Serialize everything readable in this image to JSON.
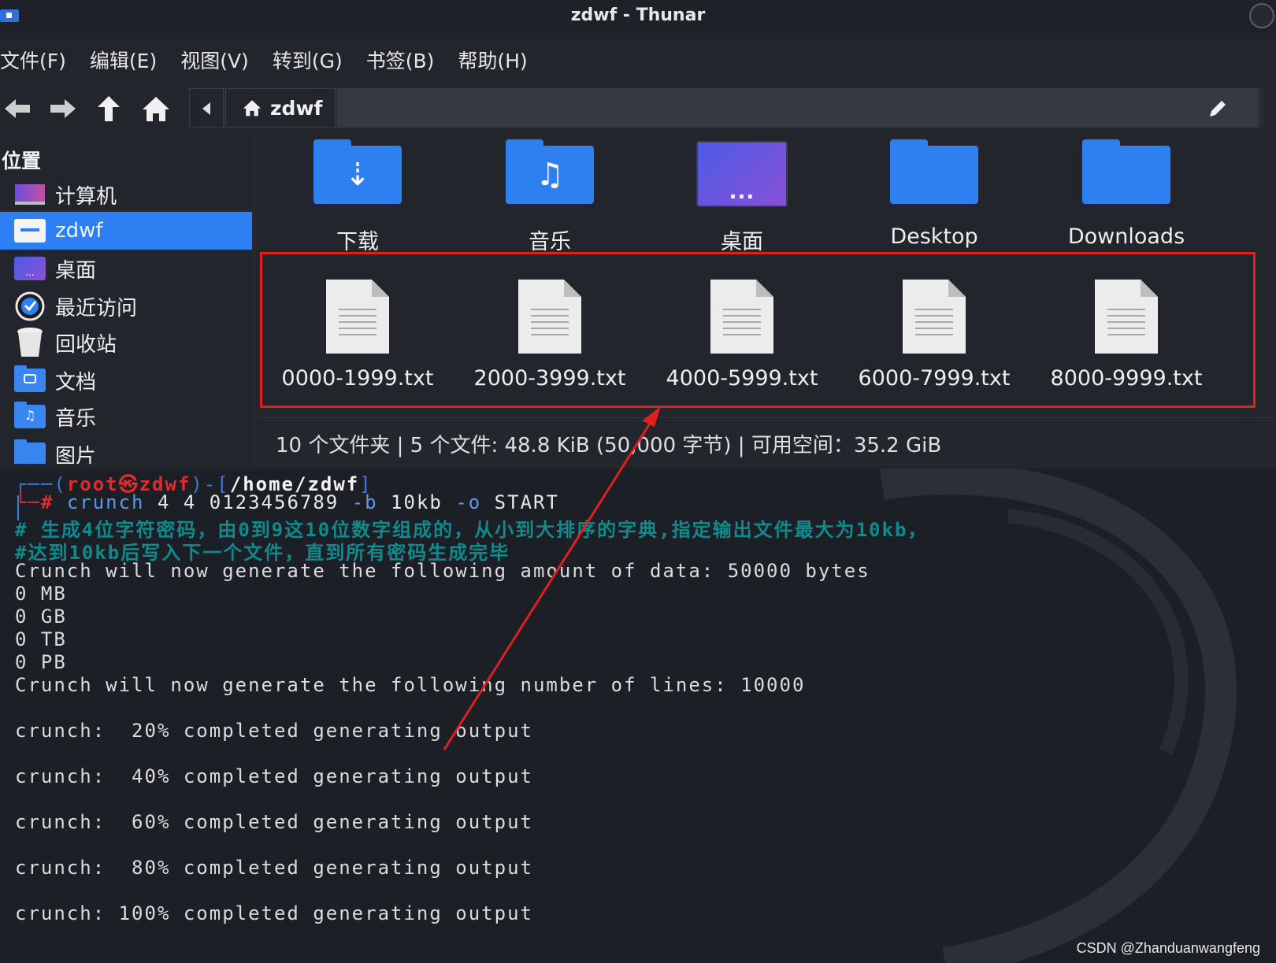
{
  "window": {
    "title": "zdwf - Thunar"
  },
  "menubar": [
    "文件(F)",
    "编辑(E)",
    "视图(V)",
    "转到(G)",
    "书签(B)",
    "帮助(H)"
  ],
  "pathbar": {
    "crumb": "zdwf"
  },
  "sidebar": {
    "heading": "位置",
    "items": [
      {
        "label": "计算机",
        "icon": "computer-icon"
      },
      {
        "label": "zdwf",
        "icon": "home-folder-icon",
        "active": true
      },
      {
        "label": "桌面",
        "icon": "desktop-folder-icon"
      },
      {
        "label": "最近访问",
        "icon": "recent-clock-icon"
      },
      {
        "label": "回收站",
        "icon": "trash-icon"
      },
      {
        "label": "文档",
        "icon": "documents-folder-icon"
      },
      {
        "label": "音乐",
        "icon": "music-folder-icon"
      },
      {
        "label": "图片",
        "icon": "pictures-folder-icon"
      }
    ]
  },
  "folders": [
    {
      "label": "下载",
      "icon": "download-folder-icon"
    },
    {
      "label": "音乐",
      "icon": "music-folder-icon"
    },
    {
      "label": "桌面",
      "icon": "desktop-folder-icon"
    },
    {
      "label": "Desktop",
      "icon": "folder-icon"
    },
    {
      "label": "Downloads",
      "icon": "folder-icon"
    }
  ],
  "files": [
    {
      "label": "0000-1999.txt"
    },
    {
      "label": "2000-3999.txt"
    },
    {
      "label": "4000-5999.txt"
    },
    {
      "label": "6000-7999.txt"
    },
    {
      "label": "8000-9999.txt"
    }
  ],
  "status": "10 个文件夹 | 5 个文件: 48.8 KiB (50,000 字节) | 可用空间：35.2 GiB",
  "terminal": {
    "prompt_open": "┌──(",
    "prompt_user": "root㉿zdwf",
    "prompt_mid": ")-[",
    "prompt_path": "/home/zdwf",
    "prompt_close": "]",
    "prompt_hash": "└─#",
    "cmd_name": "crunch",
    "cmd_args1": " 4 4 0123456789 ",
    "cmd_flag_b": "-b",
    "cmd_args2": " 10kb ",
    "cmd_flag_o": "-o",
    "cmd_args3": " START",
    "comment1": "# 生成4位字符密码，由0到9这10位数字组成的，从小到大排序的字典,指定输出文件最大为10kb，",
    "comment2": "#达到10kb后写入下一个文件，直到所有密码生成完毕",
    "output": [
      "Crunch will now generate the following amount of data: 50000 bytes",
      "0 MB",
      "0 GB",
      "0 TB",
      "0 PB",
      "Crunch will now generate the following number of lines: 10000",
      "",
      "crunch:  20% completed generating output",
      "",
      "crunch:  40% completed generating output",
      "",
      "crunch:  60% completed generating output",
      "",
      "crunch:  80% completed generating output",
      "",
      "crunch: 100% completed generating output"
    ]
  },
  "watermark": "CSDN @Zhanduanwangfeng",
  "colors": {
    "accent": "#2d7ff2",
    "highlight_box": "#e02020",
    "prompt_red": "#e02b2b",
    "comment": "#0f8b8d"
  }
}
